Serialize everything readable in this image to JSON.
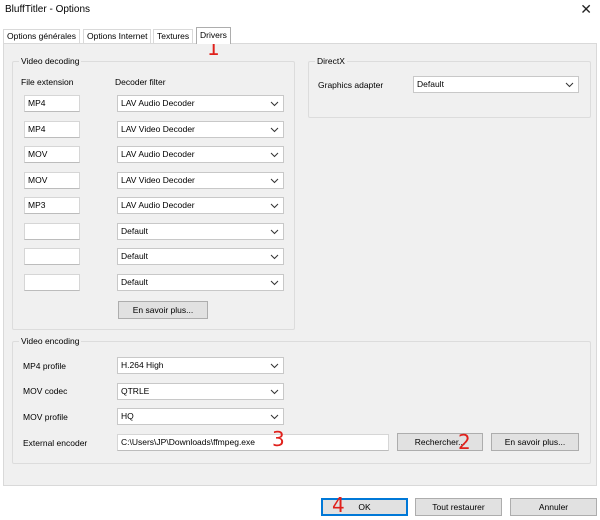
{
  "window": {
    "title": "BluffTitler - Options",
    "close_glyph": "✕"
  },
  "tabs": [
    {
      "label": "Options générales",
      "active": false
    },
    {
      "label": "Options Internet",
      "active": false
    },
    {
      "label": "Textures",
      "active": false
    },
    {
      "label": "Drivers",
      "active": true
    }
  ],
  "video_decoding": {
    "legend": "Video decoding",
    "col_extension": "File extension",
    "col_filter": "Decoder filter",
    "rows": [
      {
        "extension": "MP4",
        "filter": "LAV Audio Decoder"
      },
      {
        "extension": "MP4",
        "filter": "LAV Video Decoder"
      },
      {
        "extension": "MOV",
        "filter": "LAV Audio Decoder"
      },
      {
        "extension": "MOV",
        "filter": "LAV Video Decoder"
      },
      {
        "extension": "MP3",
        "filter": "LAV Audio Decoder"
      },
      {
        "extension": "",
        "filter": "Default"
      },
      {
        "extension": "",
        "filter": "Default"
      },
      {
        "extension": "",
        "filter": "Default"
      }
    ],
    "more_button": "En savoir plus..."
  },
  "directx": {
    "legend": "DirectX",
    "adapter_label": "Graphics adapter",
    "adapter_value": "Default"
  },
  "video_encoding": {
    "legend": "Video encoding",
    "mp4_profile_label": "MP4 profile",
    "mp4_profile_value": "H.264 High",
    "mov_codec_label": "MOV codec",
    "mov_codec_value": "QTRLE",
    "mov_profile_label": "MOV profile",
    "mov_profile_value": "HQ",
    "encoder_label": "External encoder",
    "encoder_path": "C:\\Users\\JP\\Downloads\\ffmpeg.exe",
    "browse_button": "Rechercher...",
    "more_button": "En savoir plus..."
  },
  "footer": {
    "ok": "OK",
    "restore": "Tout restaurer",
    "cancel": "Annuler"
  },
  "annotations": [
    "1",
    "2",
    "3",
    "4"
  ],
  "colors": {
    "annotation": "#e0201b",
    "default_button_border": "#0078d7",
    "panel_bg": "#f0f0f0"
  }
}
